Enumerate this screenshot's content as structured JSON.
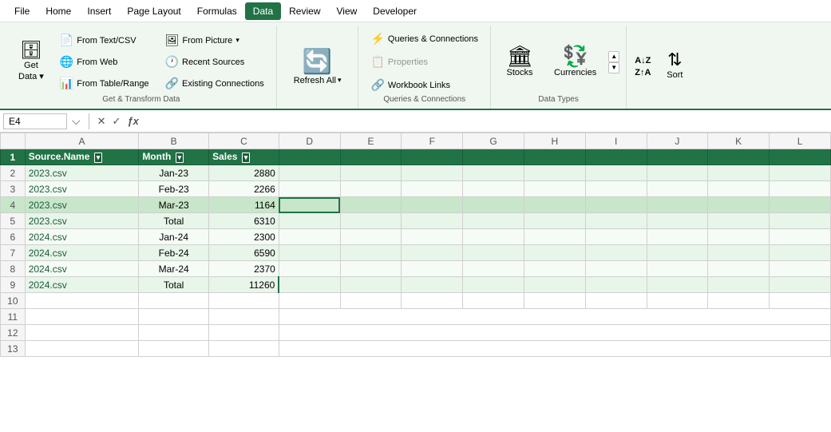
{
  "menubar": {
    "items": [
      {
        "id": "file",
        "label": "File"
      },
      {
        "id": "home",
        "label": "Home"
      },
      {
        "id": "insert",
        "label": "Insert"
      },
      {
        "id": "page-layout",
        "label": "Page Layout"
      },
      {
        "id": "formulas",
        "label": "Formulas"
      },
      {
        "id": "data",
        "label": "Data",
        "active": true
      },
      {
        "id": "review",
        "label": "Review"
      },
      {
        "id": "view",
        "label": "View"
      },
      {
        "id": "developer",
        "label": "Developer"
      }
    ]
  },
  "ribbon": {
    "groups": [
      {
        "id": "get-transform",
        "label": "Get & Transform Data",
        "buttons": [
          {
            "id": "get-data",
            "label": "Get\nData",
            "icon": "🗄",
            "has_arrow": true
          },
          {
            "id": "from-text-csv",
            "label": "From Text/CSV",
            "icon": "📄"
          },
          {
            "id": "from-web",
            "label": "From Web",
            "icon": "🌐"
          },
          {
            "id": "from-table",
            "label": "From Table/Range",
            "icon": "📊"
          },
          {
            "id": "from-picture",
            "label": "From Picture",
            "icon": "🖼",
            "has_arrow": true
          },
          {
            "id": "recent-sources",
            "label": "Recent Sources",
            "icon": "🕐"
          },
          {
            "id": "existing-connections",
            "label": "Existing Connections",
            "icon": "🔗"
          }
        ]
      },
      {
        "id": "queries-connections",
        "label": "Queries & Connections",
        "buttons": [
          {
            "id": "queries-connections",
            "label": "Queries & Connections",
            "icon": "⚡"
          },
          {
            "id": "properties",
            "label": "Properties",
            "icon": "📋",
            "disabled": true
          },
          {
            "id": "workbook-links",
            "label": "Workbook Links",
            "icon": "🔗"
          }
        ]
      },
      {
        "id": "refresh",
        "label": "",
        "refresh_label": "Refresh\nAll",
        "refresh_icon": "🔄"
      },
      {
        "id": "data-types",
        "label": "Data Types",
        "stocks_label": "Stocks",
        "stocks_icon": "📈",
        "currencies_label": "Currencies",
        "currencies_icon": "💱"
      },
      {
        "id": "sort-filter",
        "label": "",
        "sort_label": "Sort",
        "az_down_label": "A→Z",
        "za_down_label": "Z→A"
      }
    ]
  },
  "formula_bar": {
    "cell_ref": "E4",
    "formula": "",
    "placeholder": ""
  },
  "spreadsheet": {
    "columns": [
      "",
      "A",
      "B",
      "C",
      "D",
      "E",
      "F",
      "G",
      "H",
      "I",
      "J",
      "K",
      "L"
    ],
    "header_row": {
      "cells": [
        "Source.Name",
        "Month",
        "Sales"
      ],
      "col_indices": [
        1,
        2,
        3
      ]
    },
    "rows": [
      {
        "row_num": 2,
        "cells": [
          "2023.csv",
          "Jan-23",
          "2880"
        ],
        "style": "even"
      },
      {
        "row_num": 3,
        "cells": [
          "2023.csv",
          "Feb-23",
          "2266"
        ],
        "style": "odd"
      },
      {
        "row_num": 4,
        "cells": [
          "2023.csv",
          "Mar-23",
          "1164"
        ],
        "style": "selected"
      },
      {
        "row_num": 5,
        "cells": [
          "2023.csv",
          "Total",
          "6310"
        ],
        "style": "even"
      },
      {
        "row_num": 6,
        "cells": [
          "2024.csv",
          "Jan-24",
          "2300"
        ],
        "style": "odd"
      },
      {
        "row_num": 7,
        "cells": [
          "2024.csv",
          "Feb-24",
          "6590"
        ],
        "style": "even"
      },
      {
        "row_num": 8,
        "cells": [
          "2024.csv",
          "Mar-24",
          "2370"
        ],
        "style": "odd"
      },
      {
        "row_num": 9,
        "cells": [
          "2024.csv",
          "Total",
          "11260"
        ],
        "style": "even"
      },
      {
        "row_num": 10,
        "cells": [
          "",
          "",
          ""
        ],
        "style": "blank"
      },
      {
        "row_num": 11,
        "cells": [
          "",
          "",
          ""
        ],
        "style": "blank"
      },
      {
        "row_num": 12,
        "cells": [
          "",
          "",
          ""
        ],
        "style": "blank"
      },
      {
        "row_num": 13,
        "cells": [
          "",
          "",
          ""
        ],
        "style": "blank"
      }
    ]
  }
}
